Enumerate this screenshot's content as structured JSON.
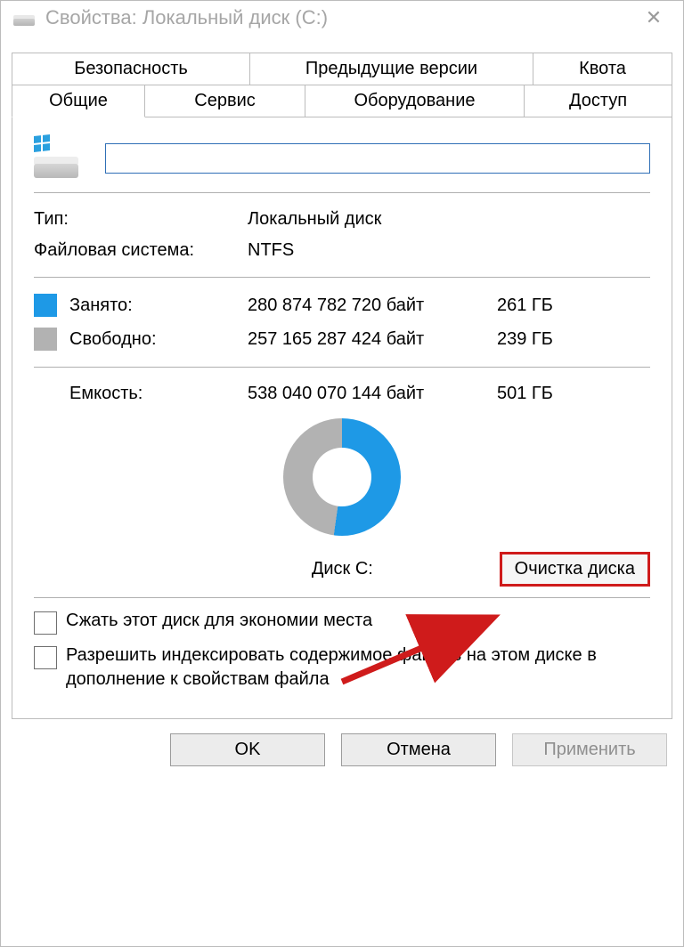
{
  "window_title": "Свойства: Локальный диск (C:)",
  "tabs_row1": [
    "Безопасность",
    "Предыдущие версии",
    "Квота"
  ],
  "tabs_row2": [
    "Общие",
    "Сервис",
    "Оборудование",
    "Доступ"
  ],
  "active_tab": "Общие",
  "disk_name_value": "",
  "type_label": "Тип:",
  "type_value": "Локальный диск",
  "fs_label": "Файловая система:",
  "fs_value": "NTFS",
  "used_label": "Занято:",
  "used_bytes": "280 874 782 720 байт",
  "used_gb": "261 ГБ",
  "free_label": "Свободно:",
  "free_bytes": "257 165 287 424 байт",
  "free_gb": "239 ГБ",
  "capacity_label": "Емкость:",
  "capacity_bytes": "538 040 070 144 байт",
  "capacity_gb": "501 ГБ",
  "disk_caption": "Диск C:",
  "cleanup_label": "Очистка диска",
  "compress_label": "Сжать этот диск для экономии места",
  "index_label": "Разрешить индексировать содержимое файлов на этом диске в дополнение к свойствам файла",
  "ok_label": "OK",
  "cancel_label": "Отмена",
  "apply_label": "Применить",
  "colors": {
    "used": "#1e99e6",
    "free": "#b2b2b2",
    "highlight": "#cf1b1b"
  },
  "chart_data": {
    "type": "pie",
    "title": "Диск C:",
    "series": [
      {
        "name": "Занято",
        "value": 261,
        "unit": "ГБ",
        "bytes": 280874782720,
        "color": "#1e99e6"
      },
      {
        "name": "Свободно",
        "value": 239,
        "unit": "ГБ",
        "bytes": 257165287424,
        "color": "#b2b2b2"
      }
    ],
    "total": {
      "name": "Емкость",
      "value": 501,
      "unit": "ГБ",
      "bytes": 538040070144
    }
  }
}
